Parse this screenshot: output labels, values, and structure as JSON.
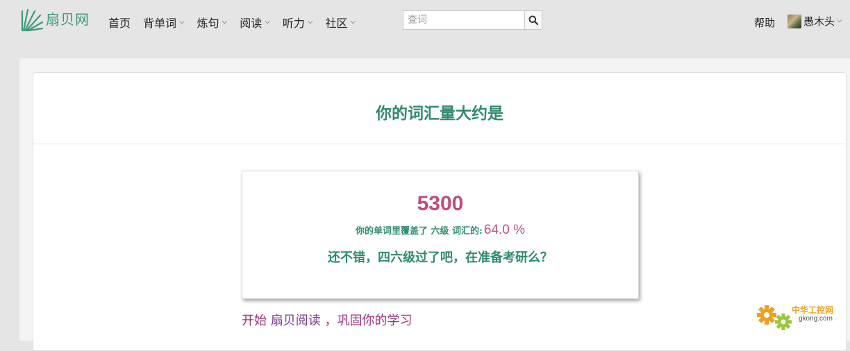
{
  "brand": {
    "name": "扇贝网",
    "accent": "#3a9b7a"
  },
  "nav": [
    {
      "label": "首页",
      "has_dropdown": false
    },
    {
      "label": "背单词",
      "has_dropdown": true
    },
    {
      "label": "炼句",
      "has_dropdown": true
    },
    {
      "label": "阅读",
      "has_dropdown": true
    },
    {
      "label": "听力",
      "has_dropdown": true
    },
    {
      "label": "社区",
      "has_dropdown": true
    }
  ],
  "search": {
    "placeholder": "查词",
    "value": ""
  },
  "header_right": {
    "help": "帮助",
    "username": "愚木头"
  },
  "result": {
    "title": "你的词汇量大约是",
    "vocab_size": "5300",
    "coverage_prefix": "你的单词里覆盖了 六级 词汇的:",
    "coverage_value": "64.0 %",
    "comment": "还不错，四六级过了吧，在准备考研么？"
  },
  "cta": {
    "part1": "开始 ",
    "link": "扇贝阅读",
    "part3": " ，巩固你的学习"
  },
  "colors": {
    "green": "#2e8b6e",
    "pink": "#c04d7e",
    "purple": "#7a3a8e"
  },
  "watermark": {
    "line1": "中华工控网",
    "line2": "gkong.com"
  }
}
